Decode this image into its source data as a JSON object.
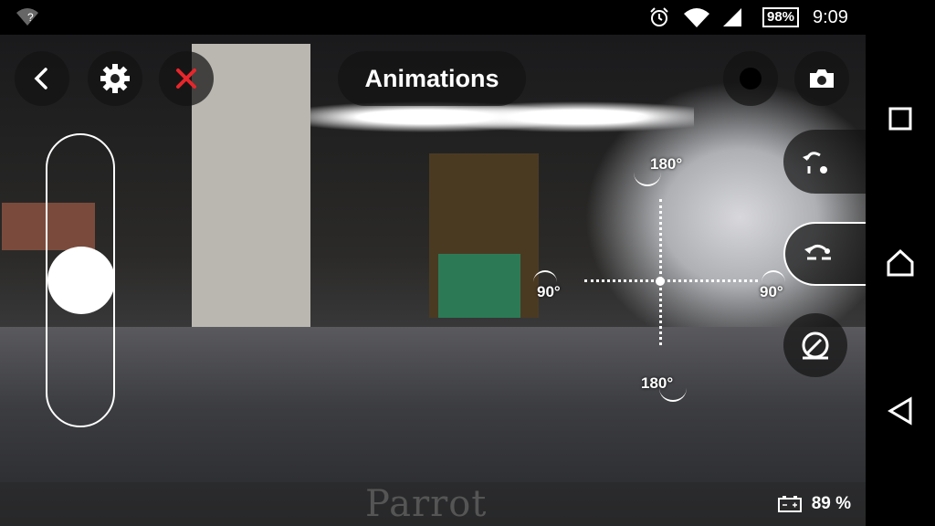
{
  "status_bar": {
    "wifi_question": "?",
    "battery_percent": "98%",
    "time": "9:09",
    "icons": [
      "wifi-question-icon",
      "alarm-icon",
      "wifi-icon",
      "signal-icon",
      "battery-icon"
    ]
  },
  "toolbar": {
    "back_icon": "chevron-left-icon",
    "settings_icon": "gear-icon",
    "close_icon": "close-icon",
    "animations_label": "Animations",
    "record_icon": "record-icon",
    "camera_icon": "camera-icon"
  },
  "flight_controls": {
    "rotate_180_top": "180°",
    "rotate_90_left": "90°",
    "rotate_90_right": "90°",
    "rotate_180_bottom": "180°"
  },
  "bottom_bar": {
    "brand": "Parrot",
    "drone_battery": "89 %"
  },
  "colors": {
    "close_red": "#e8262b",
    "overlay": "#141414"
  }
}
